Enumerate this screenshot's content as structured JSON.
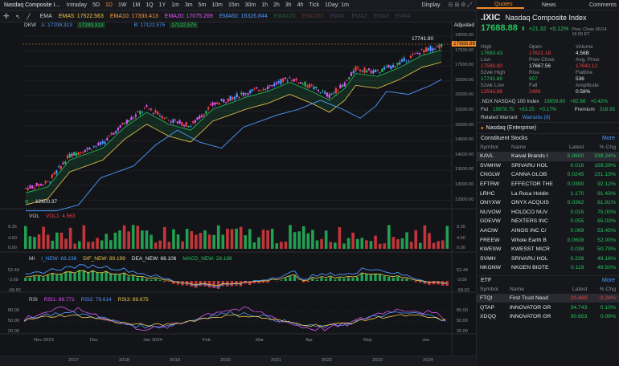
{
  "topbar": {
    "title": "Nasdaq Composite I...",
    "periods": [
      "Intraday",
      "5D",
      "1D",
      "1W",
      "1M",
      "1Q",
      "1Y",
      "1m",
      "3m",
      "5m",
      "10m",
      "15m",
      "30m",
      "1h",
      "2h",
      "3h",
      "4h",
      "Tick",
      "1Day: 1m"
    ],
    "active_period": "1D",
    "display": "Display",
    "symbols": "⊟ ⊞ ⚙ ⤢"
  },
  "ma_legend": {
    "ema_label": "EMA",
    "dkw_label": "DKW",
    "ema5": "EMA5: 17522.563",
    "ema10": "EMA10: 17333.413",
    "ema20": "EMA20: 17075.269",
    "ema60": "EMA60: 16326.844",
    "extra": [
      "EMA120",
      "EMA250",
      "EMA1",
      "EMA2",
      "EMA3",
      "EMA4"
    ],
    "dkw_a": "A: 17299.313",
    "dkw_a2": "17299.313",
    "dkw_b": "B: 17122.575",
    "dkw_b2": "17122.575",
    "adjusted": "Adjusted"
  },
  "price_axis": [
    "18000.00",
    "17500.00",
    "17000.00",
    "16500.00",
    "16000.00",
    "15500.00",
    "15000.00",
    "14500.00",
    "14000.00",
    "13500.00",
    "13000.00",
    "12500.00"
  ],
  "price_tag": "17688.88",
  "high_label": "17741.80",
  "low_label": "12600.37",
  "vol": {
    "label": "VOL",
    "vol1": "VOL1: 4.563",
    "axis": [
      "9.35",
      "4.60",
      "0.00"
    ]
  },
  "mi": {
    "label": "MI",
    "i_new": "I_NEW: 63.238",
    "dif_new": "DIF_NEW: 80.199",
    "dea_new": "DEA_NEW: 66.106",
    "macd_new": "MACD_NEW: 28.188",
    "axis": [
      "52.44",
      "-3.09",
      "-58.62"
    ]
  },
  "rsi": {
    "label": "RSI",
    "rsi1": "RSI1: 88.771",
    "rsi2": "RSI2: 79.614",
    "rsi3": "RSI3: 69.975",
    "axis": [
      "80.00",
      "50.00",
      "20.00"
    ]
  },
  "months": [
    "Nov 2023",
    "Dec",
    "Jan 2024",
    "Feb",
    "Mar",
    "Apr",
    "May",
    "Jun"
  ],
  "years": [
    "2017",
    "2018",
    "2019",
    "2020",
    "2021",
    "2022",
    "2023",
    "2024"
  ],
  "nine": "9",
  "right_panel": {
    "tabs": [
      "Quotes",
      "News",
      "Comments"
    ],
    "active_tab": "Quotes",
    "symbol": ".IXIC",
    "name": "Nasdaq Composite Index",
    "price": "17688.88",
    "arrow": "⬆",
    "change": "+21.32",
    "change_pct": "+0.12%",
    "prev_close_note": "Prev. Close 06/14 16:00 ET",
    "quote_grid": [
      {
        "label": "High",
        "value": "17693.43",
        "color": "green"
      },
      {
        "label": "Open",
        "value": "17621.18",
        "color": "red"
      },
      {
        "label": "Volume",
        "value": "4.56B",
        "color": "white"
      },
      {
        "label": "Low",
        "value": "17590.80",
        "color": "red"
      },
      {
        "label": "Prev Close",
        "value": "17667.56",
        "color": "white"
      },
      {
        "label": "Avg. Price",
        "value": "17642.12",
        "color": "red"
      },
      {
        "label": "52wk High",
        "value": "17741.80",
        "color": "green"
      },
      {
        "label": "Rise",
        "value": "907",
        "color": "green"
      },
      {
        "label": "Flatline",
        "value": "536",
        "color": "white"
      },
      {
        "label": "52wk Low",
        "value": "12543.86",
        "color": "red"
      },
      {
        "label": "Fall",
        "value": "2489",
        "color": "red"
      },
      {
        "label": "Amplitude",
        "value": "0.58%",
        "color": "white"
      }
    ],
    "ndx_label": ".NDX NASDAQ 100 Index",
    "ndx_value": "19659.80",
    "ndx_change": "+82.88",
    "ndx_pct": "+0.42%",
    "fut_label": "Fut",
    "fut_value": "19978.75",
    "fut_change": "+33.25",
    "fut_pct": "+0.17%",
    "premium_label": "Premium",
    "premium_value": "318.95",
    "related_label": "Related Warrant",
    "warrants": "Warrants (9)",
    "enterprise": "Nasdaq (Enterprise)",
    "constituent_title": "Constituent Stocks",
    "more": "More",
    "cols": [
      "Symbol",
      "Name",
      "Latest",
      "% Chg"
    ],
    "constituents": [
      {
        "sym": "KAVL",
        "name": "Kaival Brands I",
        "latest": "5.9600",
        "chg": "338.24%"
      },
      {
        "sym": "SVMHW",
        "name": "SRIVARU HOL",
        "latest": "0.016",
        "chg": "189.29%"
      },
      {
        "sym": "CNGLW",
        "name": "CANNA GLOB",
        "latest": "0.0245",
        "chg": "131.13%"
      },
      {
        "sym": "EFTRW",
        "name": "EFFECTOR THE",
        "latest": "0.0390",
        "chg": "92.12%"
      },
      {
        "sym": "LRHC",
        "name": "La Rosa Holdin",
        "latest": "1.170",
        "chg": "91.43%"
      },
      {
        "sym": "ONYXW",
        "name": "ONYX ACQUIS",
        "latest": "0.0362",
        "chg": "81.91%"
      },
      {
        "sym": "NUVOW",
        "name": "HOLDCO NUV",
        "latest": "0.015",
        "chg": "75.00%"
      },
      {
        "sym": "GDEVW",
        "name": "NEXTERS INC",
        "latest": "0.055",
        "chg": "65.03%"
      },
      {
        "sym": "AACIW",
        "name": "AINOS INC C/",
        "latest": "0.069",
        "chg": "53.45%"
      },
      {
        "sym": "FREEW",
        "name": "Whole Earth B",
        "latest": "0.0608",
        "chg": "52.00%"
      },
      {
        "sym": "KWESW",
        "name": "KWESST MICR",
        "latest": "0.038",
        "chg": "50.79%"
      },
      {
        "sym": "SVMH",
        "name": "SRIVARU HOL",
        "latest": "0.228",
        "chg": "49.18%"
      },
      {
        "sym": "NKGNW",
        "name": "NKGEN BIOTE",
        "latest": "0.119",
        "chg": "48.50%"
      }
    ],
    "etf_title": "ETF",
    "etf": [
      {
        "sym": "FTQI",
        "name": "First Trust Nasd",
        "latest": "20.460",
        "chg": "-0.24%",
        "up": false
      },
      {
        "sym": "QTAP",
        "name": "INNOVATOR GR",
        "latest": "34.743",
        "chg": "0.10%",
        "up": true
      },
      {
        "sym": "XDQQ",
        "name": "INNOVATOR GR",
        "latest": "30.653",
        "chg": "0.09%",
        "up": true
      }
    ]
  },
  "colors": {
    "up": "#22c55e",
    "down": "#ef4444",
    "accent": "#f28c28",
    "link": "#4b9bff",
    "bg": "#131418"
  }
}
